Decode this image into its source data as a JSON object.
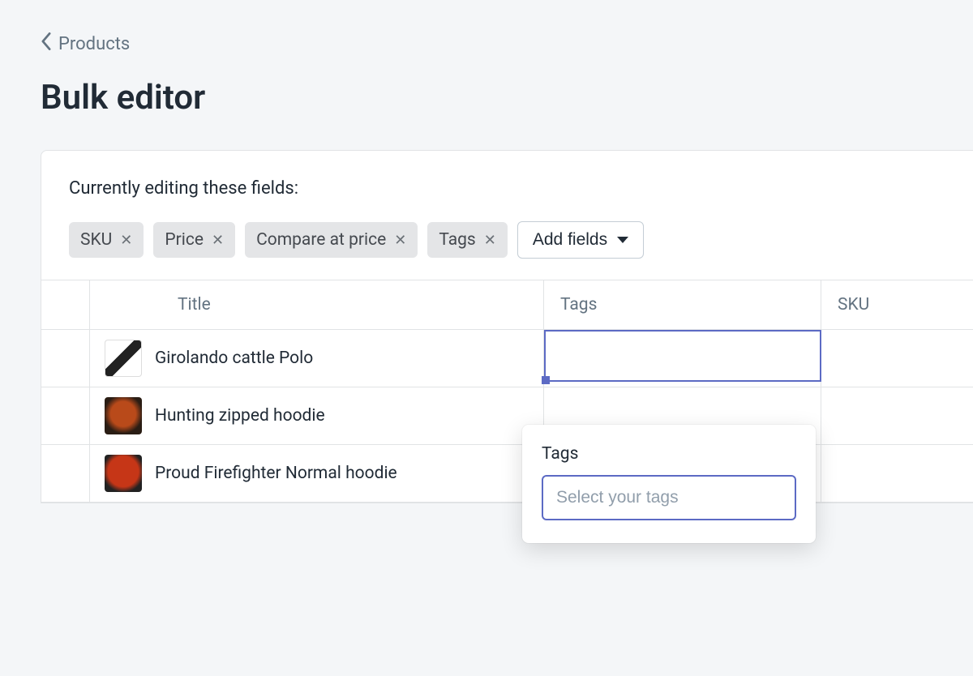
{
  "breadcrumb": {
    "label": "Products"
  },
  "title": "Bulk editor",
  "editing_label": "Currently editing these fields:",
  "chips": [
    {
      "label": "SKU"
    },
    {
      "label": "Price"
    },
    {
      "label": "Compare at price"
    },
    {
      "label": "Tags"
    }
  ],
  "add_fields_label": "Add fields",
  "columns": {
    "title": "Title",
    "tags": "Tags",
    "sku": "SKU"
  },
  "rows": [
    {
      "title": "Girolando cattle Polo",
      "thumb": "t1"
    },
    {
      "title": "Hunting zipped hoodie",
      "thumb": "t2"
    },
    {
      "title": "Proud Firefighter Normal hoodie",
      "thumb": "t3"
    }
  ],
  "popover": {
    "title": "Tags",
    "placeholder": "Select your tags"
  }
}
